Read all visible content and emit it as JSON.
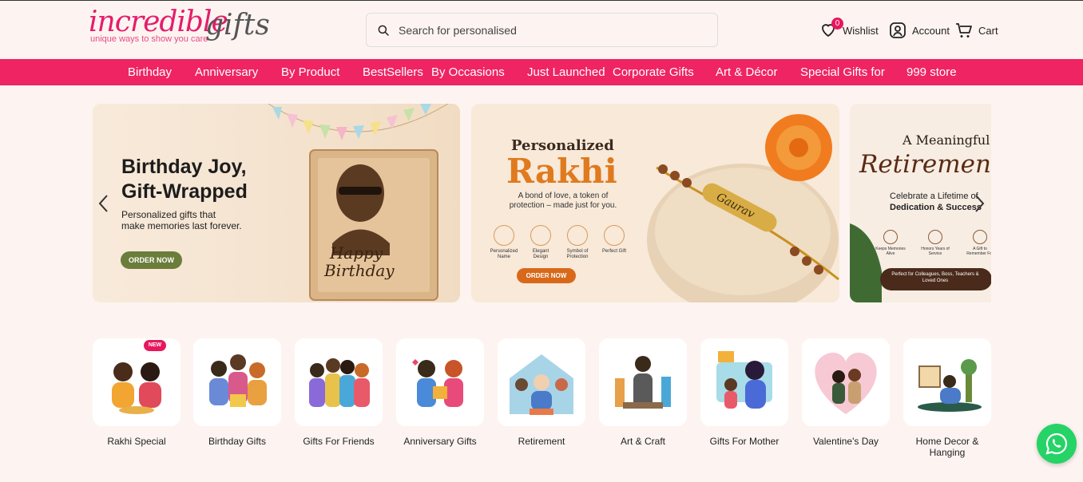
{
  "header": {
    "logo_main": "incredible",
    "logo_gifts": "gifts",
    "logo_tagline": "unique ways to show you care",
    "search_placeholder": "Search for personalised",
    "wishlist_label": "Wishlist",
    "wishlist_count": "0",
    "account_label": "Account",
    "cart_label": "Cart"
  },
  "nav": {
    "items": [
      "Birthday",
      "Anniversary",
      "By Product",
      "BestSellers",
      "By Occasions",
      "Just Launched",
      "Corporate Gifts",
      "Art & Décor",
      "Special Gifts for",
      "999 store"
    ]
  },
  "banners": {
    "b1": {
      "title1": "Birthday Joy,",
      "title2": "Gift-Wrapped",
      "sub1": "Personalized gifts that",
      "sub2": "make memories last forever.",
      "cta": "ORDER NOW",
      "frame1": "Happy",
      "frame2": "Birthday"
    },
    "b2": {
      "title1": "Personalized",
      "title2": "Rakhi",
      "sub1": "A bond of love, a token of",
      "sub2": "protection – made just for you.",
      "features": [
        "Personalized Name",
        "Elegant Design",
        "Symbol of Protection",
        "Perfect Gift"
      ],
      "cta": "ORDER NOW",
      "engraving": "Gaurav"
    },
    "b3": {
      "title1": "A Meaningful",
      "title2": "Retirement G",
      "sub1": "Celebrate a Lifetime of",
      "sub2": "Dedication & Success",
      "features": [
        "Keeps Memories Alive",
        "Honors Years of Service",
        "A Gift to Remember For"
      ],
      "footer": "Perfect for Colleagues, Boss, Teachers & Loved Ones"
    }
  },
  "categories": {
    "new_tag": "NEW",
    "items": [
      "Rakhi Special",
      "Birthday Gifts",
      "Gifts For Friends",
      "Anniversary Gifts",
      "Retirement",
      "Art & Craft",
      "Gifts For Mother",
      "Valentine's Day",
      "Home Decor & Hanging"
    ]
  },
  "colors": {
    "accent": "#ee2463",
    "background": "#fdf4f1",
    "whatsapp": "#25d366"
  }
}
